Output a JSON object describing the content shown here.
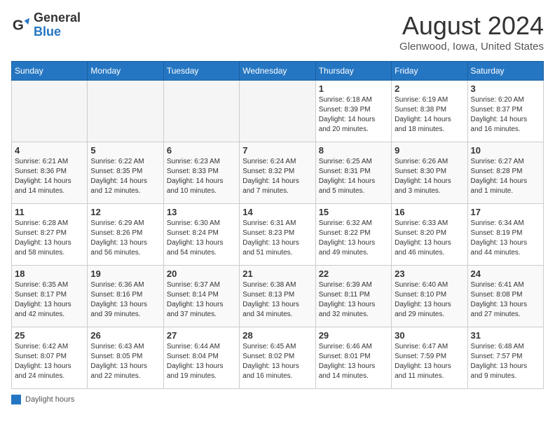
{
  "header": {
    "logo_line1": "General",
    "logo_line2": "Blue",
    "title": "August 2024",
    "subtitle": "Glenwood, Iowa, United States"
  },
  "days_of_week": [
    "Sunday",
    "Monday",
    "Tuesday",
    "Wednesday",
    "Thursday",
    "Friday",
    "Saturday"
  ],
  "weeks": [
    [
      {
        "day": "",
        "info": ""
      },
      {
        "day": "",
        "info": ""
      },
      {
        "day": "",
        "info": ""
      },
      {
        "day": "",
        "info": ""
      },
      {
        "day": "1",
        "info": "Sunrise: 6:18 AM\nSunset: 8:39 PM\nDaylight: 14 hours and 20 minutes."
      },
      {
        "day": "2",
        "info": "Sunrise: 6:19 AM\nSunset: 8:38 PM\nDaylight: 14 hours and 18 minutes."
      },
      {
        "day": "3",
        "info": "Sunrise: 6:20 AM\nSunset: 8:37 PM\nDaylight: 14 hours and 16 minutes."
      }
    ],
    [
      {
        "day": "4",
        "info": "Sunrise: 6:21 AM\nSunset: 8:36 PM\nDaylight: 14 hours and 14 minutes."
      },
      {
        "day": "5",
        "info": "Sunrise: 6:22 AM\nSunset: 8:35 PM\nDaylight: 14 hours and 12 minutes."
      },
      {
        "day": "6",
        "info": "Sunrise: 6:23 AM\nSunset: 8:33 PM\nDaylight: 14 hours and 10 minutes."
      },
      {
        "day": "7",
        "info": "Sunrise: 6:24 AM\nSunset: 8:32 PM\nDaylight: 14 hours and 7 minutes."
      },
      {
        "day": "8",
        "info": "Sunrise: 6:25 AM\nSunset: 8:31 PM\nDaylight: 14 hours and 5 minutes."
      },
      {
        "day": "9",
        "info": "Sunrise: 6:26 AM\nSunset: 8:30 PM\nDaylight: 14 hours and 3 minutes."
      },
      {
        "day": "10",
        "info": "Sunrise: 6:27 AM\nSunset: 8:28 PM\nDaylight: 14 hours and 1 minute."
      }
    ],
    [
      {
        "day": "11",
        "info": "Sunrise: 6:28 AM\nSunset: 8:27 PM\nDaylight: 13 hours and 58 minutes."
      },
      {
        "day": "12",
        "info": "Sunrise: 6:29 AM\nSunset: 8:26 PM\nDaylight: 13 hours and 56 minutes."
      },
      {
        "day": "13",
        "info": "Sunrise: 6:30 AM\nSunset: 8:24 PM\nDaylight: 13 hours and 54 minutes."
      },
      {
        "day": "14",
        "info": "Sunrise: 6:31 AM\nSunset: 8:23 PM\nDaylight: 13 hours and 51 minutes."
      },
      {
        "day": "15",
        "info": "Sunrise: 6:32 AM\nSunset: 8:22 PM\nDaylight: 13 hours and 49 minutes."
      },
      {
        "day": "16",
        "info": "Sunrise: 6:33 AM\nSunset: 8:20 PM\nDaylight: 13 hours and 46 minutes."
      },
      {
        "day": "17",
        "info": "Sunrise: 6:34 AM\nSunset: 8:19 PM\nDaylight: 13 hours and 44 minutes."
      }
    ],
    [
      {
        "day": "18",
        "info": "Sunrise: 6:35 AM\nSunset: 8:17 PM\nDaylight: 13 hours and 42 minutes."
      },
      {
        "day": "19",
        "info": "Sunrise: 6:36 AM\nSunset: 8:16 PM\nDaylight: 13 hours and 39 minutes."
      },
      {
        "day": "20",
        "info": "Sunrise: 6:37 AM\nSunset: 8:14 PM\nDaylight: 13 hours and 37 minutes."
      },
      {
        "day": "21",
        "info": "Sunrise: 6:38 AM\nSunset: 8:13 PM\nDaylight: 13 hours and 34 minutes."
      },
      {
        "day": "22",
        "info": "Sunrise: 6:39 AM\nSunset: 8:11 PM\nDaylight: 13 hours and 32 minutes."
      },
      {
        "day": "23",
        "info": "Sunrise: 6:40 AM\nSunset: 8:10 PM\nDaylight: 13 hours and 29 minutes."
      },
      {
        "day": "24",
        "info": "Sunrise: 6:41 AM\nSunset: 8:08 PM\nDaylight: 13 hours and 27 minutes."
      }
    ],
    [
      {
        "day": "25",
        "info": "Sunrise: 6:42 AM\nSunset: 8:07 PM\nDaylight: 13 hours and 24 minutes."
      },
      {
        "day": "26",
        "info": "Sunrise: 6:43 AM\nSunset: 8:05 PM\nDaylight: 13 hours and 22 minutes."
      },
      {
        "day": "27",
        "info": "Sunrise: 6:44 AM\nSunset: 8:04 PM\nDaylight: 13 hours and 19 minutes."
      },
      {
        "day": "28",
        "info": "Sunrise: 6:45 AM\nSunset: 8:02 PM\nDaylight: 13 hours and 16 minutes."
      },
      {
        "day": "29",
        "info": "Sunrise: 6:46 AM\nSunset: 8:01 PM\nDaylight: 13 hours and 14 minutes."
      },
      {
        "day": "30",
        "info": "Sunrise: 6:47 AM\nSunset: 7:59 PM\nDaylight: 13 hours and 11 minutes."
      },
      {
        "day": "31",
        "info": "Sunrise: 6:48 AM\nSunset: 7:57 PM\nDaylight: 13 hours and 9 minutes."
      }
    ]
  ],
  "legend": {
    "text": "Daylight hours"
  }
}
